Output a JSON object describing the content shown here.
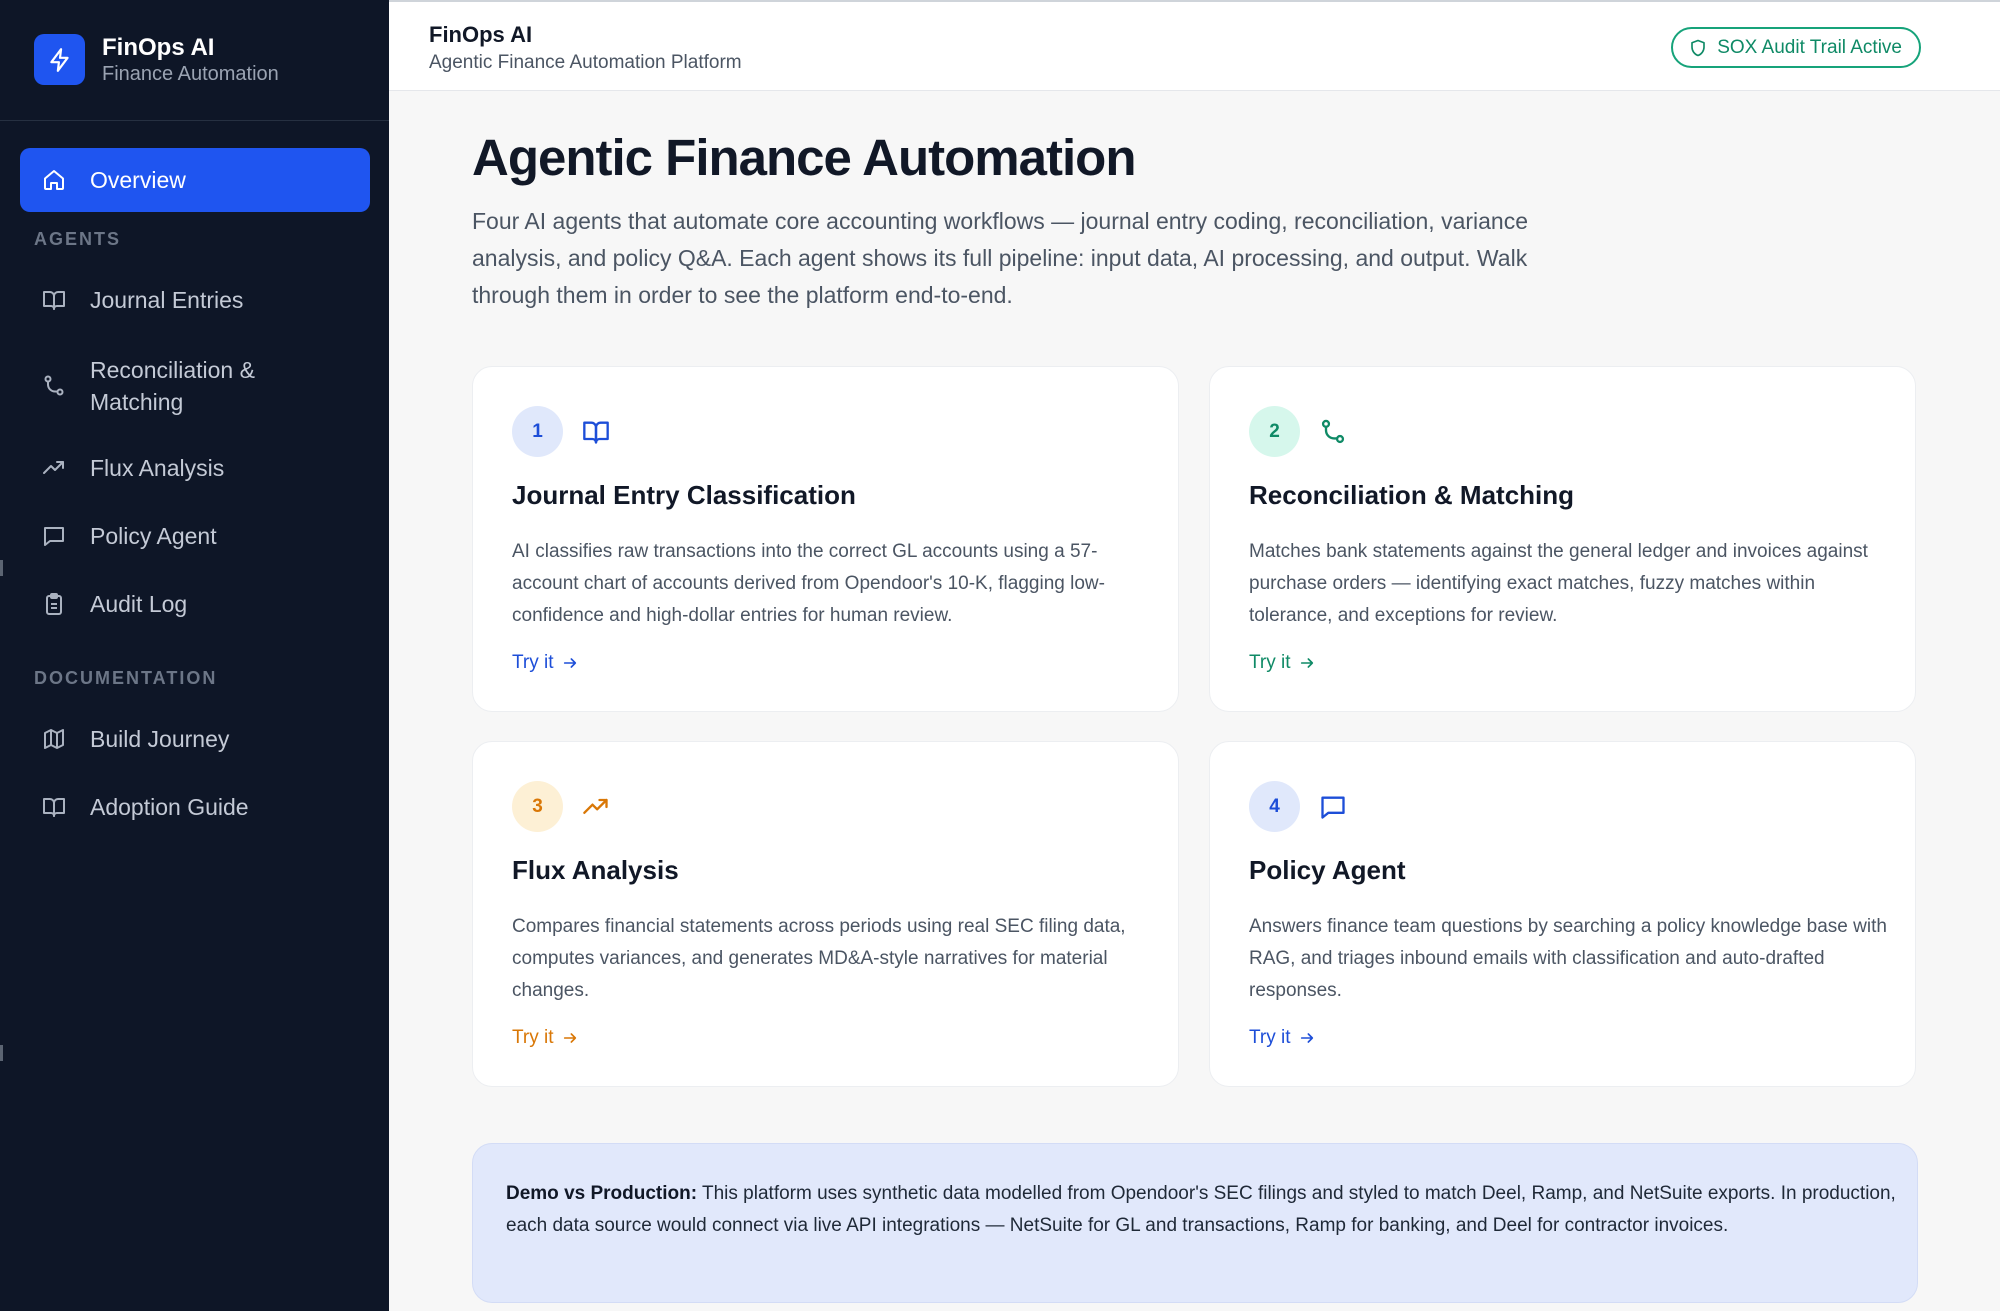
{
  "brand": {
    "title": "FinOps AI",
    "subtitle": "Finance Automation"
  },
  "sidebar": {
    "overview": {
      "label": "Overview",
      "icon": "home-icon"
    },
    "agents_heading": "AGENTS",
    "agents": [
      {
        "label": "Journal Entries",
        "icon": "book-open-icon"
      },
      {
        "label": "Reconciliation & Matching",
        "icon": "git-merge-icon"
      },
      {
        "label": "Flux Analysis",
        "icon": "trending-up-icon"
      },
      {
        "label": "Policy Agent",
        "icon": "message-square-icon"
      },
      {
        "label": "Audit Log",
        "icon": "clipboard-icon"
      }
    ],
    "docs_heading": "DOCUMENTATION",
    "docs": [
      {
        "label": "Build Journey",
        "icon": "map-icon"
      },
      {
        "label": "Adoption Guide",
        "icon": "book-open-icon"
      }
    ]
  },
  "header": {
    "title": "FinOps AI",
    "subtitle": "Agentic Finance Automation Platform",
    "badge": "SOX Audit Trail Active"
  },
  "main": {
    "title": "Agentic Finance Automation",
    "intro": "Four AI agents that automate core accounting workflows — journal entry coding, reconciliation, variance analysis, and policy Q&A. Each agent shows its full pipeline: input data, AI processing, and output. Walk through them in order to see the platform end-to-end.",
    "cards": [
      {
        "number": "1",
        "title": "Journal Entry Classification",
        "description": "AI classifies raw transactions into the correct GL accounts using a 57-account chart of accounts derived from Opendoor's 10-K, flagging low-confidence and high-dollar entries for human review.",
        "link": "Try it",
        "icon": "book-open-icon",
        "accent": "#1d4ed8",
        "badge_bg": "#e0e8fb"
      },
      {
        "number": "2",
        "title": "Reconciliation & Matching",
        "description": "Matches bank statements against the general ledger and invoices against purchase orders — identifying exact matches, fuzzy matches within tolerance, and exceptions for review.",
        "link": "Try it",
        "icon": "git-merge-icon",
        "accent": "#0f8a66",
        "badge_bg": "#d6f7ec"
      },
      {
        "number": "3",
        "title": "Flux Analysis",
        "description": "Compares financial statements across periods using real SEC filing data, computes variances, and generates MD&A-style narratives for material changes.",
        "link": "Try it",
        "icon": "trending-up-icon",
        "accent": "#d97706",
        "badge_bg": "#fdf0d5"
      },
      {
        "number": "4",
        "title": "Policy Agent",
        "description": "Answers finance team questions by searching a policy knowledge base with RAG, and triages inbound emails with classification and auto-drafted responses.",
        "link": "Try it",
        "icon": "message-square-icon",
        "accent": "#1d4ed8",
        "badge_bg": "#e0e8fb"
      }
    ],
    "note": {
      "label": "Demo vs Production:",
      "text": " This platform uses synthetic data modelled from Opendoor's SEC filings and styled to match Deel, Ramp, and NetSuite exports. In production, each data source would connect via live API integrations — NetSuite for GL and transactions, Ramp for banking, and Deel for contractor invoices."
    }
  },
  "colors": {
    "sidebar_bg": "#0e1627",
    "accent": "#1f55f0",
    "success": "#16a37a"
  }
}
